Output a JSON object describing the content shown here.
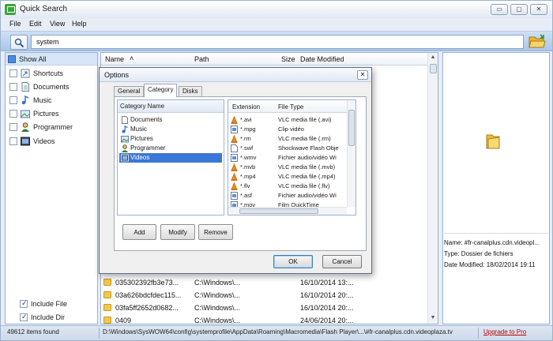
{
  "window": {
    "title": "Quick Search",
    "controls": {
      "minimize": "▭",
      "maximize": "▢",
      "close": "✕"
    }
  },
  "menu": [
    "File",
    "Edit",
    "View",
    "Help"
  ],
  "search": {
    "value": "system",
    "placeholder": ""
  },
  "sidebar": {
    "show_all": "Show All",
    "categories": [
      {
        "label": "Shortcuts",
        "icon": "shortcut-icon",
        "checked": false
      },
      {
        "label": "Documents",
        "icon": "document-icon",
        "checked": false
      },
      {
        "label": "Music",
        "icon": "music-icon",
        "checked": false
      },
      {
        "label": "Pictures",
        "icon": "picture-icon",
        "checked": false
      },
      {
        "label": "Programmer",
        "icon": "programmer-icon",
        "checked": false
      },
      {
        "label": "Videos",
        "icon": "video-icon",
        "checked": false
      }
    ],
    "include_file": "Include File",
    "include_dir": "Include Dir"
  },
  "list": {
    "columns": {
      "name": "Name",
      "sort_indicator": "˄",
      "path": "Path",
      "size": "Size",
      "date": "Date Modified"
    },
    "rows": [
      {
        "name": "035302392fb3e73...",
        "path": "C:\\Windows\\...",
        "date": "16/10/2014 13:..."
      },
      {
        "name": "03a626bdcfdec115...",
        "path": "C:\\Windows\\...",
        "date": "16/10/2014 20:..."
      },
      {
        "name": "03fa5ff2652d0682...",
        "path": "C:\\Windows\\...",
        "date": "16/10/2014 20:..."
      },
      {
        "name": "0409",
        "path": "C:\\Windows\\...",
        "date": "24/06/2014 20:..."
      }
    ]
  },
  "preview": {
    "name_line": "Name: #fr-canalplus.cdn.videopl...",
    "type_line": "Type: Dossier de fichiers",
    "date_line": "Date Modified: 18/02/2014 19:11"
  },
  "status": {
    "count": "49612 items found",
    "path": "D:\\Windows\\SysWOW64\\config\\systemprofile\\AppData\\Roaming\\Macromedia\\Flash Player\\...\\#fr-canalplus.cdn.videoplaza.tv",
    "upgrade": "Upgrade to Pro"
  },
  "dialog": {
    "title": "Options",
    "close": "✕",
    "tabs": [
      "General",
      "Category",
      "Disks"
    ],
    "active_tab": "Category",
    "category_header": "Category Name",
    "categories": [
      {
        "label": "Documents",
        "icon": "document-icon",
        "selected": false
      },
      {
        "label": "Music",
        "icon": "music-icon",
        "selected": false
      },
      {
        "label": "Pictures",
        "icon": "picture-icon",
        "selected": false
      },
      {
        "label": "Programmer",
        "icon": "programmer-icon",
        "selected": false
      },
      {
        "label": "Videos",
        "icon": "video-icon",
        "selected": true
      }
    ],
    "ext_headers": {
      "extension": "Extension",
      "file_type": "File Type"
    },
    "extensions": [
      {
        "ext": "*.avi",
        "type": "VLC media file (.avi)",
        "icon": "vlc-cone-icon"
      },
      {
        "ext": "*.mpg",
        "type": "Clip vidéo",
        "icon": "video-file-icon"
      },
      {
        "ext": "*.rm",
        "type": "VLC media file (.rm)",
        "icon": "vlc-cone-icon"
      },
      {
        "ext": "*.swf",
        "type": "Shockwave Flash Obje",
        "icon": "blank-file-icon"
      },
      {
        "ext": "*.wmv",
        "type": "Fichier audio/vidéo Wi",
        "icon": "video-file-icon"
      },
      {
        "ext": "*.mvb",
        "type": "VLC media file (.mvb)",
        "icon": "vlc-cone-icon"
      },
      {
        "ext": "*.mp4",
        "type": "VLC media file (.mp4)",
        "icon": "vlc-cone-icon"
      },
      {
        "ext": "*.flv",
        "type": "VLC media file (.flv)",
        "icon": "vlc-cone-icon"
      },
      {
        "ext": "*.asf",
        "type": "Fichier audio/vidéo Wi",
        "icon": "video-file-icon"
      },
      {
        "ext": "*.mov",
        "type": "Film QuickTime",
        "icon": "video-file-icon"
      }
    ],
    "buttons": {
      "add": "Add",
      "modify": "Modify",
      "remove": "Remove",
      "ok": "OK",
      "cancel": "Cancel"
    }
  },
  "colors": {
    "accent": "#3a77d6",
    "upgrade": "#c00000",
    "folder": "#f2c94c",
    "vlc": "#f08a1c"
  }
}
